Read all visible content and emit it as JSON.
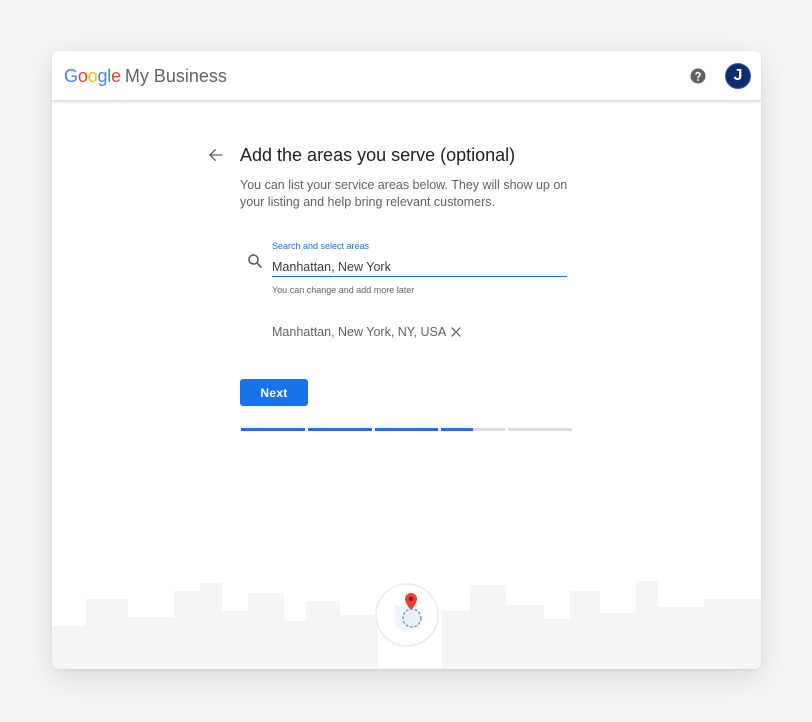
{
  "header": {
    "logo_letters": [
      {
        "char": "G",
        "color": "#4285F4"
      },
      {
        "char": "o",
        "color": "#EA4335"
      },
      {
        "char": "o",
        "color": "#FBBC05"
      },
      {
        "char": "g",
        "color": "#4285F4"
      },
      {
        "char": "l",
        "color": "#34A853"
      },
      {
        "char": "e",
        "color": "#EA4335"
      }
    ],
    "product_name": "My Business",
    "help_icon": "help-circle-icon",
    "avatar_initial": "J"
  },
  "main": {
    "back_icon": "arrow-back-icon",
    "title": "Add the areas you serve (optional)",
    "description": "You can list your service areas below. They will show up on your listing and help bring relevant customers.",
    "search": {
      "icon": "search-icon",
      "label": "Search and select areas",
      "value": "Manhattan, New York",
      "helper": "You can change and add more later"
    },
    "selected_areas": [
      {
        "label": "Manhattan, New York, NY, USA",
        "remove_icon": "close-icon"
      }
    ],
    "next_label": "Next",
    "progress": {
      "segments": [
        1,
        1,
        1,
        0.5,
        0
      ]
    }
  },
  "colors": {
    "accent": "#1a73e8",
    "avatar_bg": "#0d2c6b",
    "map_pin": "#ea4335"
  }
}
